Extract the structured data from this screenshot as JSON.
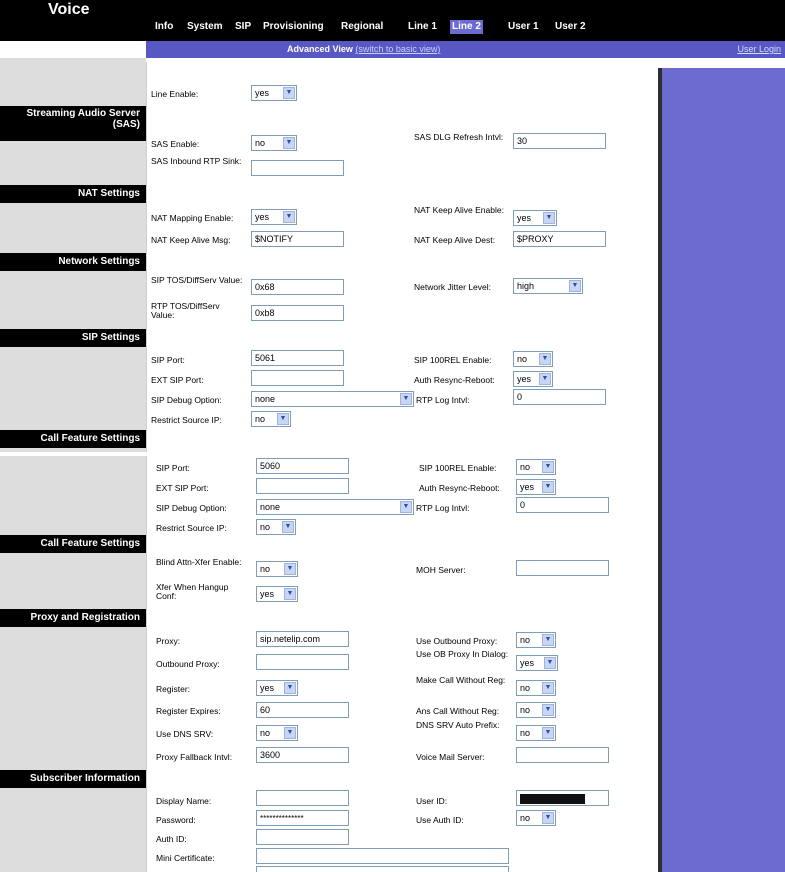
{
  "app": {
    "title": "Voice"
  },
  "nav": {
    "tabs": [
      "Info",
      "System",
      "SIP",
      "Provisioning",
      "Regional",
      "Line 1",
      "Line 2",
      "User 1",
      "User 2"
    ],
    "active": "Line 2"
  },
  "subnav": {
    "view": "Advanced View",
    "switch": "(switch to basic view)",
    "login": "User Login"
  },
  "sections": {
    "sas": [
      "Streaming Audio Server",
      "(SAS)"
    ],
    "nat": "NAT Settings",
    "network": "Network Settings",
    "sip": "SIP Settings",
    "callfeature": "Call Feature Settings",
    "proxy": "Proxy and Registration",
    "subscriber": "Subscriber Information"
  },
  "fields": {
    "line_enable": {
      "label": "Line Enable:",
      "value": "yes"
    },
    "sas_enable": {
      "label": "SAS Enable:",
      "value": "no"
    },
    "sas_dlg": {
      "label": "SAS DLG Refresh Intvl:",
      "value": "30"
    },
    "sas_rtp": {
      "label": "SAS Inbound RTP Sink:",
      "value": ""
    },
    "nat_map": {
      "label": "NAT Mapping Enable:",
      "value": "yes"
    },
    "nat_ka_en": {
      "label": "NAT Keep Alive Enable:",
      "value": "yes"
    },
    "nat_ka_msg": {
      "label": "NAT Keep Alive Msg:",
      "value": "$NOTIFY"
    },
    "nat_ka_dest": {
      "label": "NAT Keep Alive Dest:",
      "value": "$PROXY"
    },
    "sip_tos": {
      "label": "SIP TOS/DiffServ Value:",
      "value": "0x68"
    },
    "jitter": {
      "label": "Network Jitter Level:",
      "value": "high"
    },
    "rtp_tos": {
      "label": "RTP TOS/DiffServ Value:",
      "value": "0xb8"
    },
    "sip_port_a": {
      "label": "SIP Port:",
      "value": "5061"
    },
    "sip_100rel_a": {
      "label": "SIP 100REL Enable:",
      "value": "no"
    },
    "ext_sip_a": {
      "label": "EXT SIP Port:",
      "value": ""
    },
    "auth_resync_a": {
      "label": "Auth Resync-Reboot:",
      "value": "yes"
    },
    "sip_debug_a": {
      "label": "SIP Debug Option:",
      "value": "none"
    },
    "rtp_log_a": {
      "label": "RTP Log Intvl:",
      "value": "0"
    },
    "restrict_a": {
      "label": "Restrict Source IP:",
      "value": "no"
    },
    "sip_port_b": {
      "label": "SIP Port:",
      "value": "5060"
    },
    "sip_100rel_b": {
      "label": "SIP 100REL Enable:",
      "value": "no"
    },
    "ext_sip_b": {
      "label": "EXT SIP Port:",
      "value": ""
    },
    "auth_resync_b": {
      "label": "Auth Resync-Reboot:",
      "value": "yes"
    },
    "sip_debug_b": {
      "label": "SIP Debug Option:",
      "value": "none"
    },
    "rtp_log_b": {
      "label": "RTP Log Intvl:",
      "value": "0"
    },
    "restrict_b": {
      "label": "Restrict Source IP:",
      "value": "no"
    },
    "blind_xfer": {
      "label": "Blind Attn-Xfer Enable:",
      "value": "no"
    },
    "moh": {
      "label": "MOH Server:",
      "value": ""
    },
    "xfer_hangup": {
      "label": "Xfer When Hangup Conf:",
      "value": "yes"
    },
    "proxy": {
      "label": "Proxy:",
      "value": "sip.netelip.com"
    },
    "use_ob_proxy": {
      "label": "Use Outbound Proxy:",
      "value": "no"
    },
    "ob_proxy": {
      "label": "Outbound Proxy:",
      "value": ""
    },
    "use_ob_dialog": {
      "label": "Use OB Proxy In Dialog:",
      "value": "yes"
    },
    "register": {
      "label": "Register:",
      "value": "yes"
    },
    "make_call": {
      "label": "Make Call Without Reg:",
      "value": "no"
    },
    "reg_expires": {
      "label": "Register Expires:",
      "value": "60"
    },
    "ans_call": {
      "label": "Ans Call Without Reg:",
      "value": "no"
    },
    "use_dns": {
      "label": "Use DNS SRV:",
      "value": "no"
    },
    "dns_prefix": {
      "label": "DNS SRV Auto Prefix:",
      "value": "no"
    },
    "proxy_fb": {
      "label": "Proxy Fallback Intvl:",
      "value": "3600"
    },
    "vm_server": {
      "label": "Voice Mail Server:",
      "value": ""
    },
    "display_name": {
      "label": "Display Name:",
      "value": ""
    },
    "user_id": {
      "label": "User ID:",
      "value": ""
    },
    "password": {
      "label": "Password:",
      "value": "**************"
    },
    "use_auth": {
      "label": "Use Auth ID:",
      "value": "no"
    },
    "auth_id": {
      "label": "Auth ID:",
      "value": ""
    },
    "mini_cert": {
      "label": "Mini Certificate:",
      "value": ""
    }
  },
  "icons": {
    "dropdown": "chevron-down-icon"
  },
  "colors": {
    "purple": "#6b6bd0",
    "subbar": "#5858c4",
    "black": "#000000"
  }
}
